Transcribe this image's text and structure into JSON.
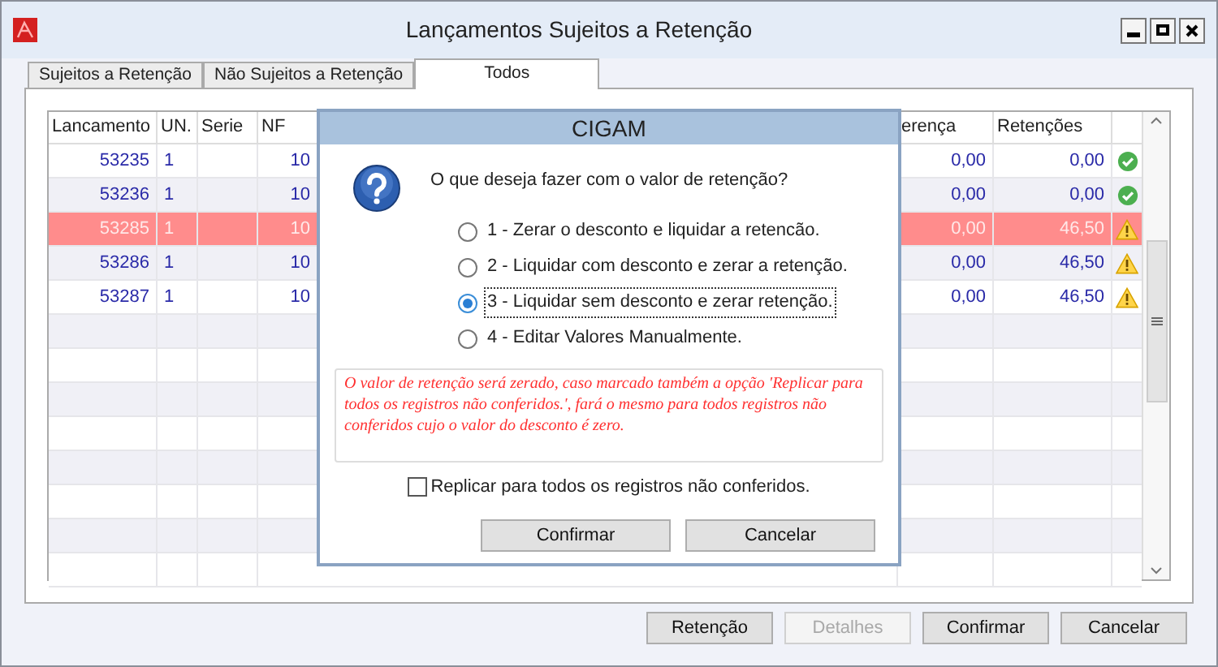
{
  "window": {
    "title": "Lançamentos Sujeitos a Retenção"
  },
  "tabs": [
    {
      "label": "Sujeitos a Retenção",
      "selected": false
    },
    {
      "label": "Não Sujeitos a Retenção",
      "selected": false
    },
    {
      "label": "Todos",
      "selected": true
    }
  ],
  "table": {
    "columns": [
      "Lancamento",
      "UN.",
      "Serie",
      "NF",
      "erença",
      "Retenções"
    ],
    "rows": [
      {
        "lancamento": "53235",
        "un": "1",
        "nf": "10",
        "diferenca": "0,00",
        "retencoes": "0,00",
        "kind": "ok",
        "selected": false
      },
      {
        "lancamento": "53236",
        "un": "1",
        "nf": "10",
        "diferenca": "0,00",
        "retencoes": "0,00",
        "kind": "ok",
        "selected": false
      },
      {
        "lancamento": "53285",
        "un": "1",
        "nf": "10",
        "diferenca": "0,00",
        "retencoes": "46,50",
        "kind": "warning",
        "selected": true
      },
      {
        "lancamento": "53286",
        "un": "1",
        "nf": "10",
        "diferenca": "0,00",
        "retencoes": "46,50",
        "kind": "warning",
        "selected": false
      },
      {
        "lancamento": "53287",
        "un": "1",
        "nf": "10",
        "diferenca": "0,00",
        "retencoes": "46,50",
        "kind": "warning",
        "selected": false
      }
    ]
  },
  "dialog": {
    "title": "CIGAM",
    "question": "O que deseja fazer com o valor de retenção?",
    "options": [
      {
        "label": "1 - Zerar o desconto e liquidar a retencão.",
        "selected": false
      },
      {
        "label": "2 - Liquidar com desconto e zerar a retenção.",
        "selected": false
      },
      {
        "label": "3 - Liquidar sem desconto e zerar retenção.",
        "selected": true
      },
      {
        "label": "4 - Editar Valores Manualmente.",
        "selected": false
      }
    ],
    "note": "O valor de retenção será zerado, caso marcado também a opção 'Replicar para todos os registros não conferidos.', fará o mesmo para todos registros não conferidos  cujo o valor do desconto é zero.",
    "replicate": {
      "label": "Replicar para todos os registros não conferidos.",
      "checked": false
    },
    "buttons": [
      "Confirmar",
      "Cancelar"
    ]
  },
  "buttons": [
    {
      "label": "Retenção",
      "disabled": false
    },
    {
      "label": "Detalhes",
      "disabled": true
    },
    {
      "label": "Confirmar",
      "disabled": false
    },
    {
      "label": "Cancelar",
      "disabled": false
    }
  ]
}
